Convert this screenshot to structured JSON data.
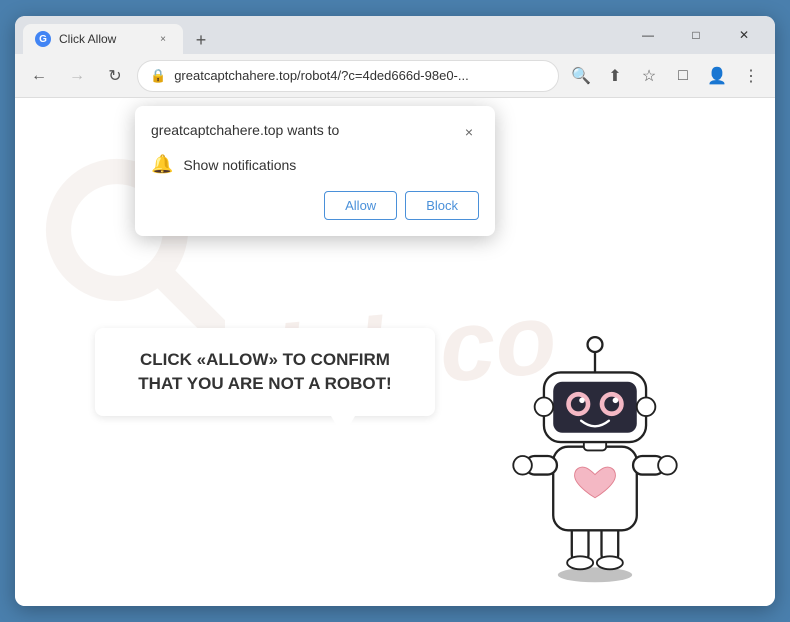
{
  "browser": {
    "tab": {
      "favicon_label": "G",
      "title": "Click Allow",
      "close_label": "×"
    },
    "new_tab_label": "+",
    "window_controls": {
      "minimize": "—",
      "maximize": "□",
      "close": "✕"
    },
    "nav": {
      "back_label": "←",
      "forward_label": "→",
      "refresh_label": "↻",
      "url": "greatcaptchahere.top/robot4/?c=4ded666d-98e0-...",
      "search_icon": "🔍",
      "share_icon": "⬆",
      "bookmark_icon": "☆",
      "phone_icon": "□",
      "profile_icon": "👤",
      "menu_icon": "⋮"
    }
  },
  "popup": {
    "site_text": "greatcaptchahere.top wants to",
    "close_label": "×",
    "notification_icon": "🔔",
    "notification_label": "Show notifications",
    "allow_button": "Allow",
    "block_button": "Block"
  },
  "page": {
    "captcha_message": "CLICK «ALLOW» TO CONFIRM THAT YOU ARE NOT A ROBOT!",
    "watermark_text": "risk.co"
  }
}
